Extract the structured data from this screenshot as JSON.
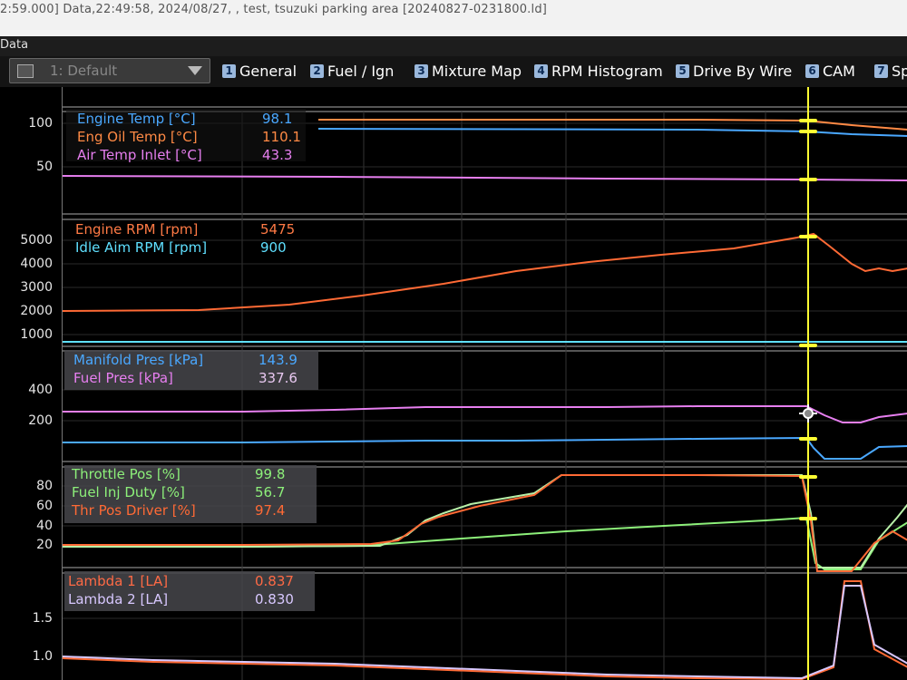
{
  "window_title": "2:59.000] Data,22:49:58, 2024/08/27, , test, tsuzuki parking area [20240827-0231800.ld]",
  "menu": {
    "data_label": "Data"
  },
  "toolbar": {
    "workspace_label": "1: Default",
    "tabs": [
      {
        "num": "1",
        "label": "General"
      },
      {
        "num": "2",
        "label": "Fuel / Ign"
      },
      {
        "num": "3",
        "label": "Mixture Map"
      },
      {
        "num": "4",
        "label": "RPM Histogram"
      },
      {
        "num": "5",
        "label": "Drive By Wire"
      },
      {
        "num": "6",
        "label": "CAM"
      },
      {
        "num": "7",
        "label": "Sp"
      }
    ]
  },
  "colors": {
    "orange": "#ff7a45",
    "blue": "#4aa8ff",
    "magenta": "#e77ff0",
    "cyan": "#5fe0ff",
    "green": "#8df07a",
    "lavender": "#d8c8ff",
    "cursor": "#ffff33"
  },
  "panels": {
    "temps": {
      "ticks": [
        "100",
        "50"
      ],
      "channels": [
        {
          "name": "Engine Temp [°C]",
          "value": "98.1"
        },
        {
          "name": "Eng Oil Temp [°C]",
          "value": "110.1"
        },
        {
          "name": "Air Temp Inlet [°C]",
          "value": "43.3"
        }
      ]
    },
    "rpm": {
      "ticks": [
        "5000",
        "4000",
        "3000",
        "2000",
        "1000"
      ],
      "channels": [
        {
          "name": "Engine RPM [rpm]",
          "value": "5475"
        },
        {
          "name": "Idle Aim RPM [rpm]",
          "value": "900"
        }
      ]
    },
    "pressure": {
      "ticks": [
        "400",
        "200"
      ],
      "channels": [
        {
          "name": "Manifold Pres [kPa]",
          "value": "143.9"
        },
        {
          "name": "Fuel Pres [kPa]",
          "value": "337.6"
        }
      ]
    },
    "throttle": {
      "ticks": [
        "80",
        "60",
        "40",
        "20"
      ],
      "channels": [
        {
          "name": "Throttle Pos [%]",
          "value": "99.8"
        },
        {
          "name": "Fuel Inj Duty [%]",
          "value": "56.7"
        },
        {
          "name": "Thr Pos Driver [%]",
          "value": "97.4"
        }
      ]
    },
    "lambda": {
      "ticks": [
        "1.5",
        "1.0"
      ],
      "channels": [
        {
          "name": "Lambda 1 [LA]",
          "value": "0.837"
        },
        {
          "name": "Lambda 2 [LA]",
          "value": "0.830"
        }
      ]
    }
  }
}
